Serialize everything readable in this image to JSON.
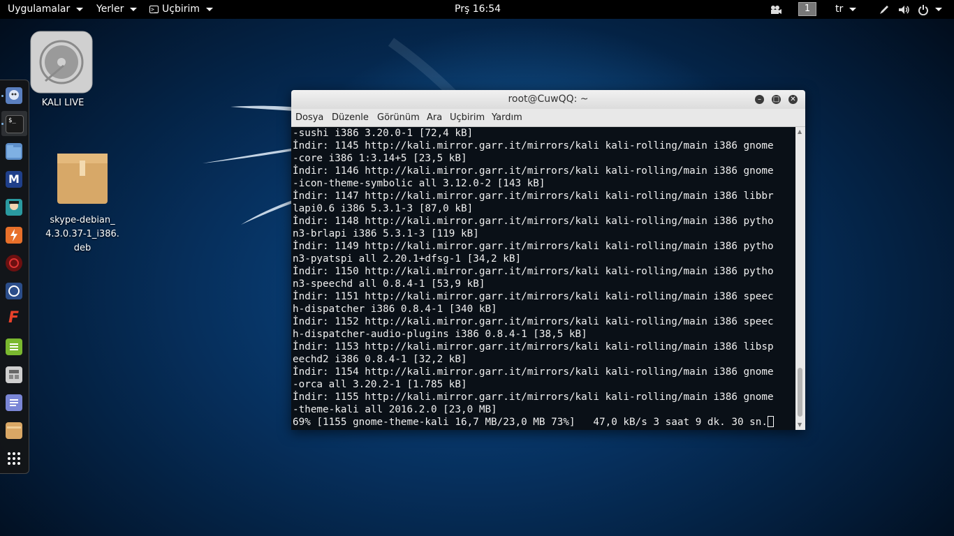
{
  "topbar": {
    "applications": "Uygulamalar",
    "places": "Yerler",
    "terminal_app": "Uçbirim",
    "clock": "Prş 16:54",
    "workspace": "1",
    "language": "tr"
  },
  "desktop": {
    "kali_live_label": "KALI LIVE",
    "skype_label_line1": "skype-debian_",
    "skype_label_line2": "4.3.0.37-1_i386.",
    "skype_label_line3": "deb"
  },
  "window": {
    "title": "root@CuwQQ: ~",
    "menu": [
      "Dosya",
      "Düzenle",
      "Görünüm",
      "Ara",
      "Uçbirim",
      "Yardım"
    ]
  },
  "terminal": {
    "lines": [
      "-sushi i386 3.20.0-1 [72,4 kB]",
      "İndir: 1145 http://kali.mirror.garr.it/mirrors/kali kali-rolling/main i386 gnome",
      "-core i386 1:3.14+5 [23,5 kB]",
      "İndir: 1146 http://kali.mirror.garr.it/mirrors/kali kali-rolling/main i386 gnome",
      "-icon-theme-symbolic all 3.12.0-2 [143 kB]",
      "İndir: 1147 http://kali.mirror.garr.it/mirrors/kali kali-rolling/main i386 libbr",
      "lapi0.6 i386 5.3.1-3 [87,0 kB]",
      "İndir: 1148 http://kali.mirror.garr.it/mirrors/kali kali-rolling/main i386 pytho",
      "n3-brlapi i386 5.3.1-3 [119 kB]",
      "İndir: 1149 http://kali.mirror.garr.it/mirrors/kali kali-rolling/main i386 pytho",
      "n3-pyatspi all 2.20.1+dfsg-1 [34,2 kB]",
      "İndir: 1150 http://kali.mirror.garr.it/mirrors/kali kali-rolling/main i386 pytho",
      "n3-speechd all 0.8.4-1 [53,9 kB]",
      "İndir: 1151 http://kali.mirror.garr.it/mirrors/kali kali-rolling/main i386 speec",
      "h-dispatcher i386 0.8.4-1 [340 kB]",
      "İndir: 1152 http://kali.mirror.garr.it/mirrors/kali kali-rolling/main i386 speec",
      "h-dispatcher-audio-plugins i386 0.8.4-1 [38,5 kB]",
      "İndir: 1153 http://kali.mirror.garr.it/mirrors/kali kali-rolling/main i386 libsp",
      "eechd2 i386 0.8.4-1 [32,2 kB]",
      "İndir: 1154 http://kali.mirror.garr.it/mirrors/kali kali-rolling/main i386 gnome",
      "-orca all 3.20.2-1 [1.785 kB]",
      "İndir: 1155 http://kali.mirror.garr.it/mirrors/kali kali-rolling/main i386 gnome",
      "-theme-kali all 2016.2.0 [23,0 MB]"
    ],
    "progress_line": "69% [1155 gnome-theme-kali 16,7 MB/23,0 MB 73%]   47,0 kB/s 3 saat 9 dk. 30 sn."
  },
  "dock_icons": [
    "pidgin-icon",
    "terminal-icon",
    "files-icon",
    "metasploit-icon",
    "armitage-icon",
    "burpsuite-icon",
    "faraday-icon",
    "maltego-icon",
    "ffuf-icon",
    "notes-icon",
    "calculator-icon",
    "text-editor-icon",
    "archive-icon",
    "show-apps-icon"
  ],
  "colors": {
    "accent": "#0b4a8a",
    "terminal_bg": "#080e16",
    "topbar_bg": "#000000"
  }
}
